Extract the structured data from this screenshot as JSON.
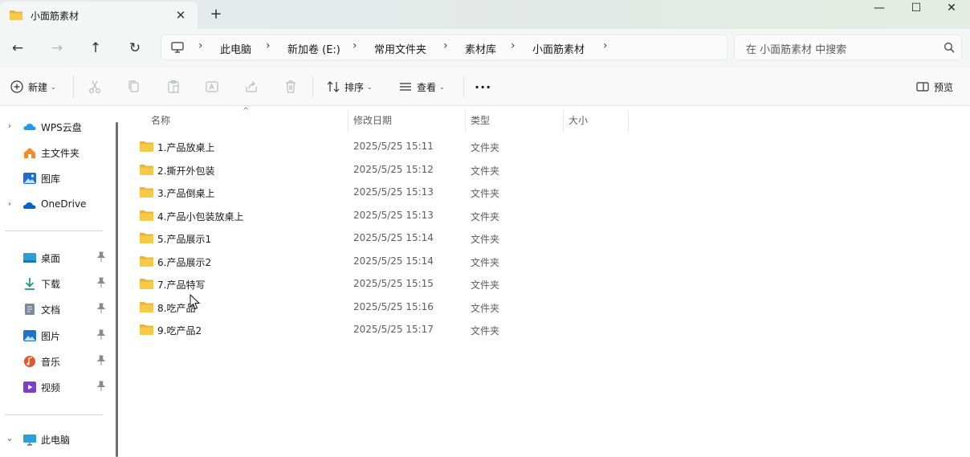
{
  "tab": {
    "title": "小面筋素材",
    "close": "✕",
    "new": "+"
  },
  "window": {
    "minimize": "—",
    "maximize": "☐",
    "close": "✕"
  },
  "nav": {
    "back": "←",
    "forward": "→",
    "up": "↑",
    "refresh": "↻"
  },
  "breadcrumb": [
    "此电脑",
    "新加卷 (E:)",
    "常用文件夹",
    "素材库",
    "小面筋素材"
  ],
  "breadcrumb_sep": "›",
  "search": {
    "placeholder": "在 小面筋素材 中搜索"
  },
  "toolbar": {
    "new_label": "新建",
    "sort_label": "排序",
    "view_label": "查看",
    "more_label": "···",
    "preview_label": "预览",
    "caret": "⌄"
  },
  "sidebar": {
    "group1": [
      {
        "label": "WPS云盘",
        "expand": "›",
        "icon": "wps-cloud-icon",
        "color": "#1d9bf0"
      },
      {
        "label": "主文件夹",
        "expand": "",
        "icon": "home-icon",
        "color": "#f28c28"
      },
      {
        "label": "图库",
        "expand": "",
        "icon": "gallery-icon",
        "color": "#1f6fd1"
      },
      {
        "label": "OneDrive",
        "expand": "›",
        "icon": "onedrive-icon",
        "color": "#0a64c8"
      }
    ],
    "group2": [
      {
        "label": "桌面",
        "icon": "desktop-icon",
        "color": "#2a9fd8"
      },
      {
        "label": "下载",
        "icon": "download-icon",
        "color": "#1e9b6f"
      },
      {
        "label": "文档",
        "icon": "documents-icon",
        "color": "#7a8a99"
      },
      {
        "label": "图片",
        "icon": "pictures-icon",
        "color": "#1f73c9"
      },
      {
        "label": "音乐",
        "icon": "music-icon",
        "color": "#e2572e"
      },
      {
        "label": "视频",
        "icon": "video-icon",
        "color": "#7a3fcb"
      }
    ],
    "group3": [
      {
        "label": "此电脑",
        "expand": "⌄",
        "icon": "this-pc-icon",
        "color": "#2a9fd8"
      }
    ]
  },
  "columns": {
    "name": "名称",
    "date": "修改日期",
    "type": "类型",
    "size": "大小",
    "sort_indicator": "^"
  },
  "files": [
    {
      "name": "1.产品放桌上",
      "date": "2025/5/25 15:11",
      "type": "文件夹"
    },
    {
      "name": "2.撕开外包装",
      "date": "2025/5/25 15:12",
      "type": "文件夹"
    },
    {
      "name": "3.产品倒桌上",
      "date": "2025/5/25 15:13",
      "type": "文件夹"
    },
    {
      "name": "4.产品小包装放桌上",
      "date": "2025/5/25 15:13",
      "type": "文件夹"
    },
    {
      "name": "5.产品展示1",
      "date": "2025/5/25 15:14",
      "type": "文件夹"
    },
    {
      "name": "6.产品展示2",
      "date": "2025/5/25 15:14",
      "type": "文件夹"
    },
    {
      "name": "7.产品特写",
      "date": "2025/5/25 15:15",
      "type": "文件夹"
    },
    {
      "name": "8.吃产品",
      "date": "2025/5/25 15:16",
      "type": "文件夹"
    },
    {
      "name": "9.吃产品2",
      "date": "2025/5/25 15:17",
      "type": "文件夹"
    }
  ],
  "colors": {
    "folder": "#f7c948",
    "folder_dark": "#e8b43a",
    "accent": "#0067c0"
  }
}
